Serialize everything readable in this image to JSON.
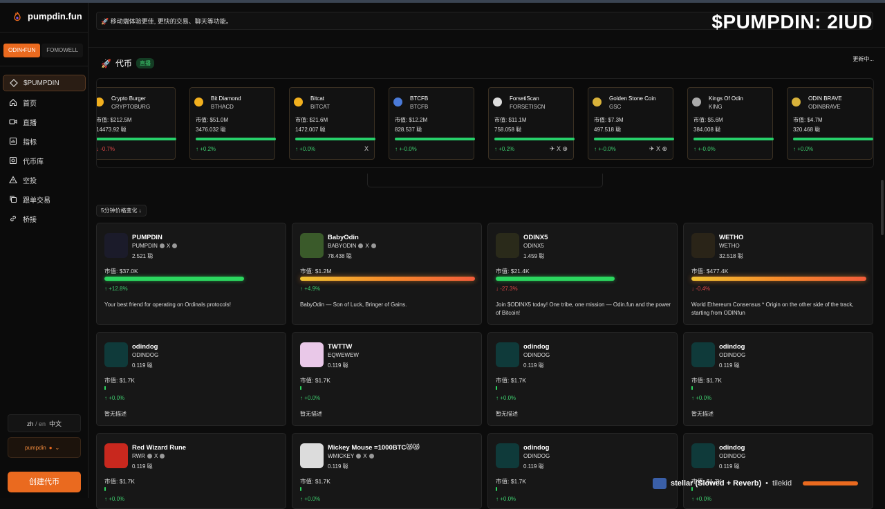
{
  "app": {
    "name": "pumpdin.fun"
  },
  "overlay_title": "$PUMPDIN: 2IUD",
  "sidebar": {
    "tabs": [
      "ODIN•FUN",
      "FOMOWELL"
    ],
    "items": [
      {
        "label": "$PUMPDIN",
        "icon": "diamond-icon"
      },
      {
        "label": "首页",
        "icon": "home-icon"
      },
      {
        "label": "直播",
        "icon": "video-icon"
      },
      {
        "label": "指标",
        "icon": "chart-icon"
      },
      {
        "label": "代币库",
        "icon": "library-icon"
      },
      {
        "label": "空投",
        "icon": "airdrop-icon"
      },
      {
        "label": "跟单交易",
        "icon": "copy-icon"
      },
      {
        "label": "桥接",
        "icon": "link-icon"
      }
    ],
    "lang_zh": "zh",
    "lang_sep": "/",
    "lang_en": "en",
    "lang_label": "中文",
    "user": "pumpdin",
    "create_label": "创建代币"
  },
  "banner": "移动端体验更佳, 更快的交易、聊天等功能。",
  "section": {
    "title": "代币",
    "live": "直播",
    "updating": "更新中..."
  },
  "tickers": [
    {
      "name": "Crypto Burger",
      "sym": "CRYPTOBURG",
      "mcap": "市值: $212.5M",
      "hold": "14473.92 聪",
      "chg": "↓ -0.7%",
      "dir": "down",
      "socials": ""
    },
    {
      "name": "Bit Diamond",
      "sym": "BTHACD",
      "mcap": "市值: $51.0M",
      "hold": "3476.032 聪",
      "chg": "↑ +0.2%",
      "dir": "up",
      "socials": ""
    },
    {
      "name": "Bitcat",
      "sym": "BITCAT",
      "mcap": "市值: $21.6M",
      "hold": "1472.007 聪",
      "chg": "↑ +0.0%",
      "dir": "up",
      "socials": "X"
    },
    {
      "name": "BTCFB",
      "sym": "BTCFB",
      "mcap": "市值: $12.2M",
      "hold": "828.537 聪",
      "chg": "↑ +-0.0%",
      "dir": "up",
      "socials": ""
    },
    {
      "name": "ForsetiScan",
      "sym": "FORSETISCN",
      "mcap": "市值: $11.1M",
      "hold": "758.058 聪",
      "chg": "↑ +0.2%",
      "dir": "up",
      "socials": "✈ X ⊕"
    },
    {
      "name": "Golden Stone Coin",
      "sym": "GSC",
      "mcap": "市值: $7.3M",
      "hold": "497.518 聪",
      "chg": "↑ +-0.0%",
      "dir": "up",
      "socials": "✈ X ⊕"
    },
    {
      "name": "Kings Of Odin",
      "sym": "KING",
      "mcap": "市值: $5.6M",
      "hold": "384.008 聪",
      "chg": "↑ +-0.0%",
      "dir": "up",
      "socials": ""
    },
    {
      "name": "ODIN BRAVE",
      "sym": "ODINBRAVE",
      "mcap": "市值: $4.7M",
      "hold": "320.468 聪",
      "chg": "↑ +0.0%",
      "dir": "up",
      "socials": ""
    }
  ],
  "sort_label": "5分钟价格变化 ↓",
  "cards": [
    {
      "name": "PUMPDIN",
      "sym": "PUMPDIN",
      "socials": true,
      "hold": "2.521 聪",
      "mcap": "市值: $37.0K",
      "bar": "green",
      "bar_level": 0.8,
      "chg": "↑ +12.8%",
      "dir": "up",
      "desc": "Your best friend for operating on Ordinals protocols!",
      "avatar": "#1b1b2a"
    },
    {
      "name": "BabyOdin",
      "sym": "BABYODIN",
      "socials": true,
      "hold": "78.438 聪",
      "mcap": "市值: $1.2M",
      "bar": "fire",
      "bar_level": 1.0,
      "chg": "↑ +4.9%",
      "dir": "up",
      "desc": "BabyOdin — Son of Luck, Bringer of Gains.",
      "avatar": "#3a5a2a"
    },
    {
      "name": "ODINX5",
      "sym": "ODINX5",
      "socials": false,
      "hold": "1.459 聪",
      "mcap": "市值: $21.4K",
      "bar": "green",
      "bar_level": 0.68,
      "chg": "↓ -27.3%",
      "dir": "down",
      "desc": "Join $ODINX5 today! One tribe, one mission — Odin.fun and the power of Bitcoin!",
      "avatar": "#2a2a1a"
    },
    {
      "name": "WETHO",
      "sym": "WETHO",
      "socials": false,
      "hold": "32.518 聪",
      "mcap": "市值: $477.4K",
      "bar": "fire",
      "bar_level": 1.0,
      "chg": "↓ -0.4%",
      "dir": "down",
      "desc": "World Ethereum Consensus * Origin on the other side of the track, starting from ODINfun",
      "avatar": "#2a2418"
    },
    {
      "name": "odindog",
      "sym": "ODINDOG",
      "socials": false,
      "hold": "0.119 聪",
      "mcap": "市值: $1.7K",
      "bar": "tiny",
      "bar_level": 0.01,
      "chg": "↑ +0.0%",
      "dir": "up",
      "desc": "暂无描述",
      "avatar": "#0f3a3a"
    },
    {
      "name": "TWTTW",
      "sym": "EQWEWEW",
      "socials": false,
      "hold": "0.119 聪",
      "mcap": "市值: $1.7K",
      "bar": "tiny",
      "bar_level": 0.01,
      "chg": "↑ +0.0%",
      "dir": "up",
      "desc": "暂无描述",
      "avatar": "#e9c8e8"
    },
    {
      "name": "odindog",
      "sym": "ODINDOG",
      "socials": false,
      "hold": "0.119 聪",
      "mcap": "市值: $1.7K",
      "bar": "tiny",
      "bar_level": 0.01,
      "chg": "↑ +0.0%",
      "dir": "up",
      "desc": "暂无描述",
      "avatar": "#0f3a3a"
    },
    {
      "name": "odindog",
      "sym": "ODINDOG",
      "socials": false,
      "hold": "0.119 聪",
      "mcap": "市值: $1.7K",
      "bar": "tiny",
      "bar_level": 0.01,
      "chg": "↑ +0.0%",
      "dir": "up",
      "desc": "暂无描述",
      "avatar": "#0f3a3a"
    },
    {
      "name": "Red Wizard Rune",
      "sym": "RWR",
      "socials": true,
      "hold": "0.119 聪",
      "mcap": "市值: $1.7K",
      "bar": "tiny",
      "bar_level": 0.01,
      "chg": "↑ +0.0%",
      "dir": "up",
      "desc": "",
      "avatar": "#c8281e"
    },
    {
      "name": "Mickey Mouse =1000BTC😻😻",
      "sym": "WMICKEY",
      "socials": true,
      "hold": "0.119 聪",
      "mcap": "市值: $1.7K",
      "bar": "tiny",
      "bar_level": 0.01,
      "chg": "↑ +0.0%",
      "dir": "up",
      "desc": "",
      "avatar": "#dcdcdc"
    },
    {
      "name": "odindog",
      "sym": "ODINDOG",
      "socials": false,
      "hold": "0.119 聪",
      "mcap": "市值: $1.7K",
      "bar": "tiny",
      "bar_level": 0.01,
      "chg": "↑ +0.0%",
      "dir": "up",
      "desc": "",
      "avatar": "#0f3a3a"
    },
    {
      "name": "odindog",
      "sym": "ODINDOG",
      "socials": false,
      "hold": "0.119 聪",
      "mcap": "市值: $1.7K",
      "bar": "tiny",
      "bar_level": 0.01,
      "chg": "↑ +0.0%",
      "dir": "up",
      "desc": "",
      "avatar": "#0f3a3a"
    }
  ],
  "music": {
    "title": "stellar (Slowed + Reverb)",
    "sep": "•",
    "artist": "tilekid"
  },
  "colors": {
    "accent": "#ea6a1f",
    "up": "#3ecf6f",
    "down": "#e04848",
    "bar_green": "#2bd65e"
  }
}
